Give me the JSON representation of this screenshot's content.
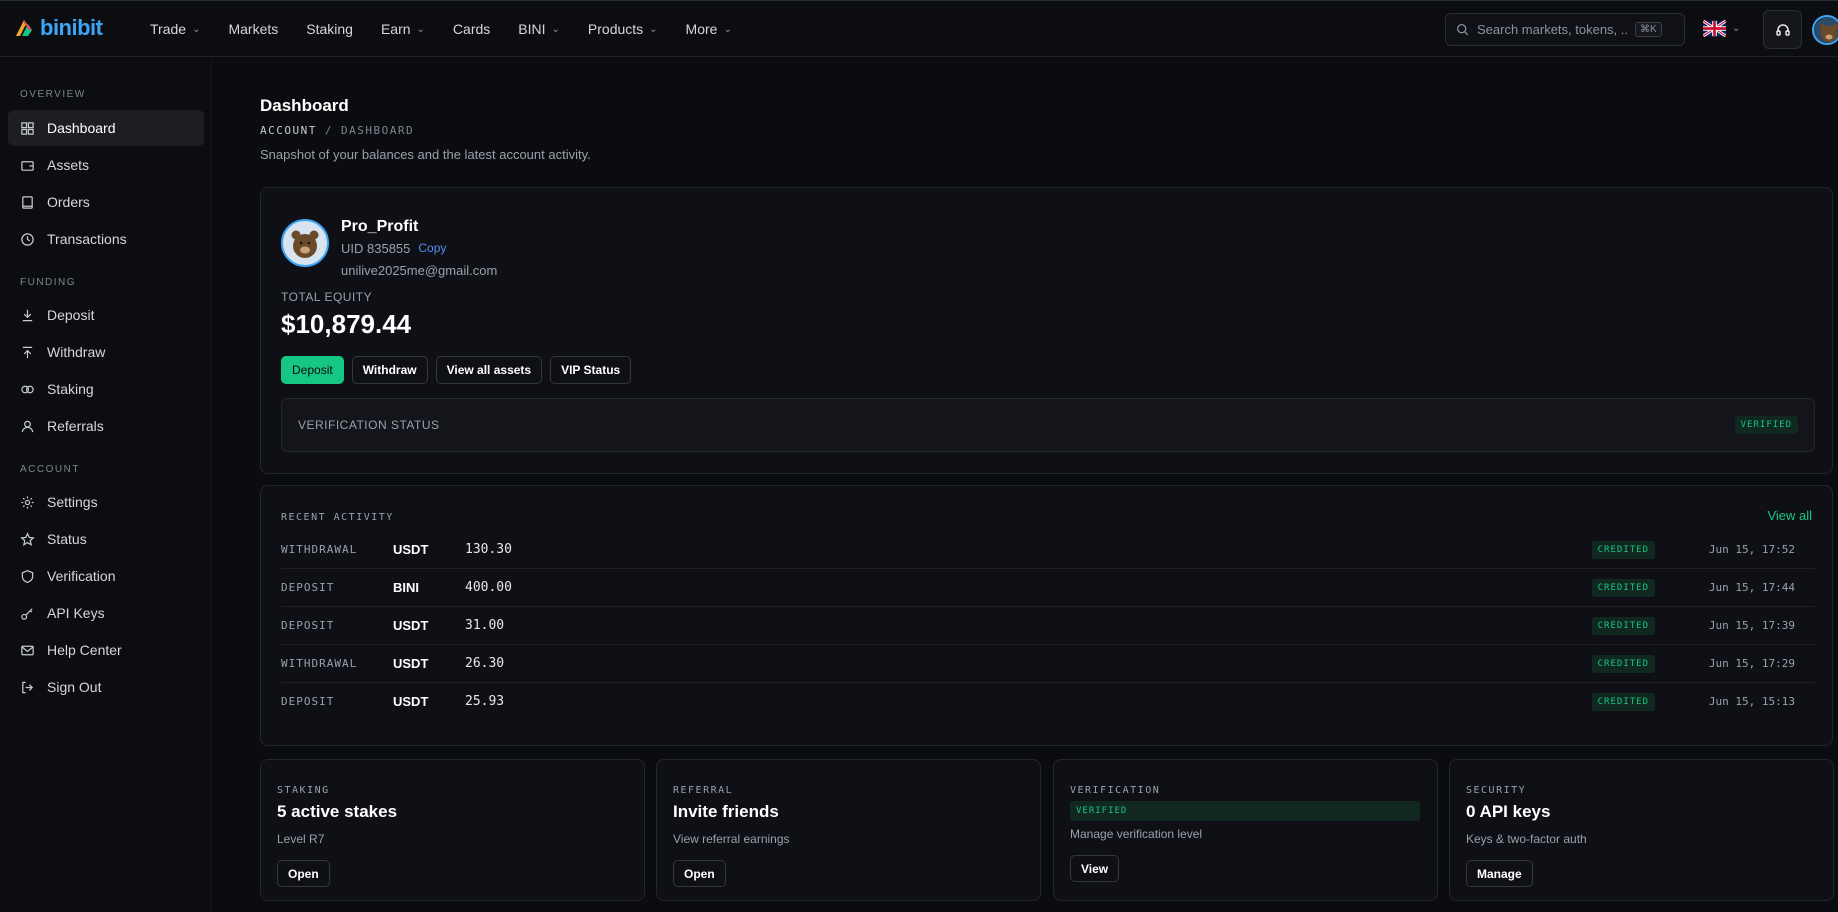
{
  "brand": {
    "name": "binibit"
  },
  "nav": {
    "items": [
      {
        "label": "Trade",
        "dropdown": true
      },
      {
        "label": "Markets",
        "dropdown": false
      },
      {
        "label": "Staking",
        "dropdown": false
      },
      {
        "label": "Earn",
        "dropdown": true
      },
      {
        "label": "Cards",
        "dropdown": false
      },
      {
        "label": "BINI",
        "dropdown": true
      },
      {
        "label": "Products",
        "dropdown": true
      },
      {
        "label": "More",
        "dropdown": true
      }
    ],
    "search_placeholder": "Search markets, tokens, ...",
    "search_shortcut": "⌘K"
  },
  "sidebar": {
    "sections": [
      {
        "label": "OVERVIEW"
      },
      {
        "label": "FUNDING"
      },
      {
        "label": "ACCOUNT"
      }
    ],
    "items": [
      {
        "label": "Dashboard",
        "icon": "grid-icon",
        "active": true
      },
      {
        "label": "Assets",
        "icon": "wallet-icon"
      },
      {
        "label": "Orders",
        "icon": "book-icon"
      },
      {
        "label": "Transactions",
        "icon": "clock-icon"
      },
      {
        "label": "Deposit",
        "icon": "download-icon"
      },
      {
        "label": "Withdraw",
        "icon": "upload-icon"
      },
      {
        "label": "Staking",
        "icon": "rings-icon"
      },
      {
        "label": "Referrals",
        "icon": "user-icon"
      },
      {
        "label": "Settings",
        "icon": "gear-icon"
      },
      {
        "label": "Status",
        "icon": "star-icon"
      },
      {
        "label": "Verification",
        "icon": "shield-icon"
      },
      {
        "label": "API Keys",
        "icon": "key-icon"
      },
      {
        "label": "Help Center",
        "icon": "mail-icon"
      },
      {
        "label": "Sign Out",
        "icon": "logout-icon"
      }
    ]
  },
  "page": {
    "title": "Dashboard",
    "breadcrumb": [
      "ACCOUNT",
      "/",
      "DASHBOARD"
    ],
    "subtitle": "Snapshot of your balances and the latest account activity."
  },
  "profile": {
    "name": "Pro_Profit",
    "uid": "UID 835855",
    "copy_label": "Copy",
    "email": "unilive2025me@gmail.com",
    "equity_label": "TOTAL EQUITY",
    "equity_value": "$10,879.44",
    "buttons": {
      "deposit": "Deposit",
      "withdraw": "Withdraw",
      "view_assets": "View all assets",
      "vip": "VIP Status"
    },
    "verification_label": "VERIFICATION STATUS",
    "verification_badge": "VERIFIED"
  },
  "activity": {
    "title": "RECENT ACTIVITY",
    "view_all": "View all",
    "rows": [
      {
        "type": "WITHDRAWAL",
        "asset": "USDT",
        "amount": "130.30",
        "status": "CREDITED",
        "time": "Jun 15, 17:52"
      },
      {
        "type": "DEPOSIT",
        "asset": "BINI",
        "amount": "400.00",
        "status": "CREDITED",
        "time": "Jun 15, 17:44"
      },
      {
        "type": "DEPOSIT",
        "asset": "USDT",
        "amount": "31.00",
        "status": "CREDITED",
        "time": "Jun 15, 17:39"
      },
      {
        "type": "WITHDRAWAL",
        "asset": "USDT",
        "amount": "26.30",
        "status": "CREDITED",
        "time": "Jun 15, 17:29"
      },
      {
        "type": "DEPOSIT",
        "asset": "USDT",
        "amount": "25.93",
        "status": "CREDITED",
        "time": "Jun 15, 15:13"
      }
    ]
  },
  "cards": {
    "staking": {
      "label": "STAKING",
      "title": "5 active stakes",
      "sub": "Level R7",
      "button": "Open"
    },
    "referral": {
      "label": "REFERRAL",
      "title": "Invite friends",
      "sub": "View referral earnings",
      "button": "Open"
    },
    "verification": {
      "label": "VERIFICATION",
      "badge": "VERIFIED",
      "sub": "Manage verification level",
      "button": "View"
    },
    "security": {
      "label": "SECURITY",
      "title": "0 API keys",
      "sub": "Keys & two-factor auth",
      "button": "Manage"
    }
  },
  "colors": {
    "accent": "#16c784",
    "link": "#4f8ff7",
    "brand": "#3da5f5",
    "bg": "#0b0c10"
  }
}
